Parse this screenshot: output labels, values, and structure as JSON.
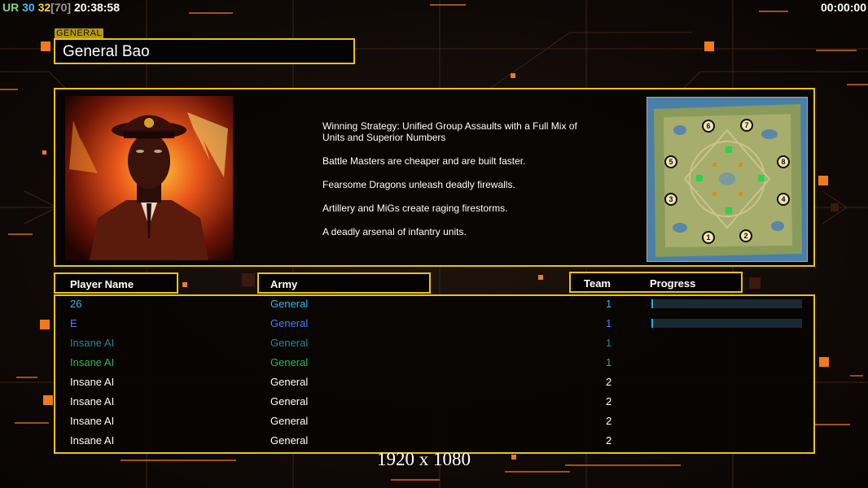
{
  "hud": {
    "left": [
      {
        "text": "UR",
        "color": "#7cd67c"
      },
      {
        "text": " 30",
        "color": "#49b7ff"
      },
      {
        "text": " 32",
        "color": "#ffd52a"
      },
      {
        "text": "[70]",
        "color": "#9a9a9a"
      },
      {
        "text": " 20:38:58",
        "color": "#ffffff"
      }
    ],
    "right": "00:00:00"
  },
  "general": {
    "tag": "GENERAL",
    "name": "General Bao"
  },
  "strategy": [
    "Winning Strategy: Unified Group Assaults with a Full Mix of Units and Superior Numbers",
    "Battle Masters are cheaper and are built faster.",
    "Fearsome Dragons unleash deadly firewalls.",
    "Artillery and MiGs create raging firestorms.",
    "A deadly arsenal of infantry units."
  ],
  "map": {
    "start_positions": [
      "1",
      "2",
      "3",
      "4",
      "5",
      "6",
      "7",
      "8"
    ]
  },
  "headers": {
    "player_name": "Player Name",
    "army": "Army",
    "team": "Team",
    "progress": "Progress"
  },
  "players": [
    {
      "name": "26",
      "army": "General",
      "team": "1",
      "color": "#36b6e8",
      "progress": 0.01
    },
    {
      "name": "E",
      "army": "General",
      "team": "1",
      "color": "#4f79ff",
      "progress": 0.01
    },
    {
      "name": "Insane AI",
      "army": "General",
      "team": "1",
      "color": "#1d8a98"
    },
    {
      "name": "Insane AI",
      "army": "General",
      "team": "1",
      "color": "#2fb84a"
    },
    {
      "name": "Insane AI",
      "army": "General",
      "team": "2",
      "color": "#ffffff"
    },
    {
      "name": "Insane AI",
      "army": "General",
      "team": "2",
      "color": "#ffffff"
    },
    {
      "name": "Insane AI",
      "army": "General",
      "team": "2",
      "color": "#ffffff"
    },
    {
      "name": "Insane AI",
      "army": "General",
      "team": "2",
      "color": "#ffffff"
    }
  ],
  "resolution_label": "1920 x 1080"
}
